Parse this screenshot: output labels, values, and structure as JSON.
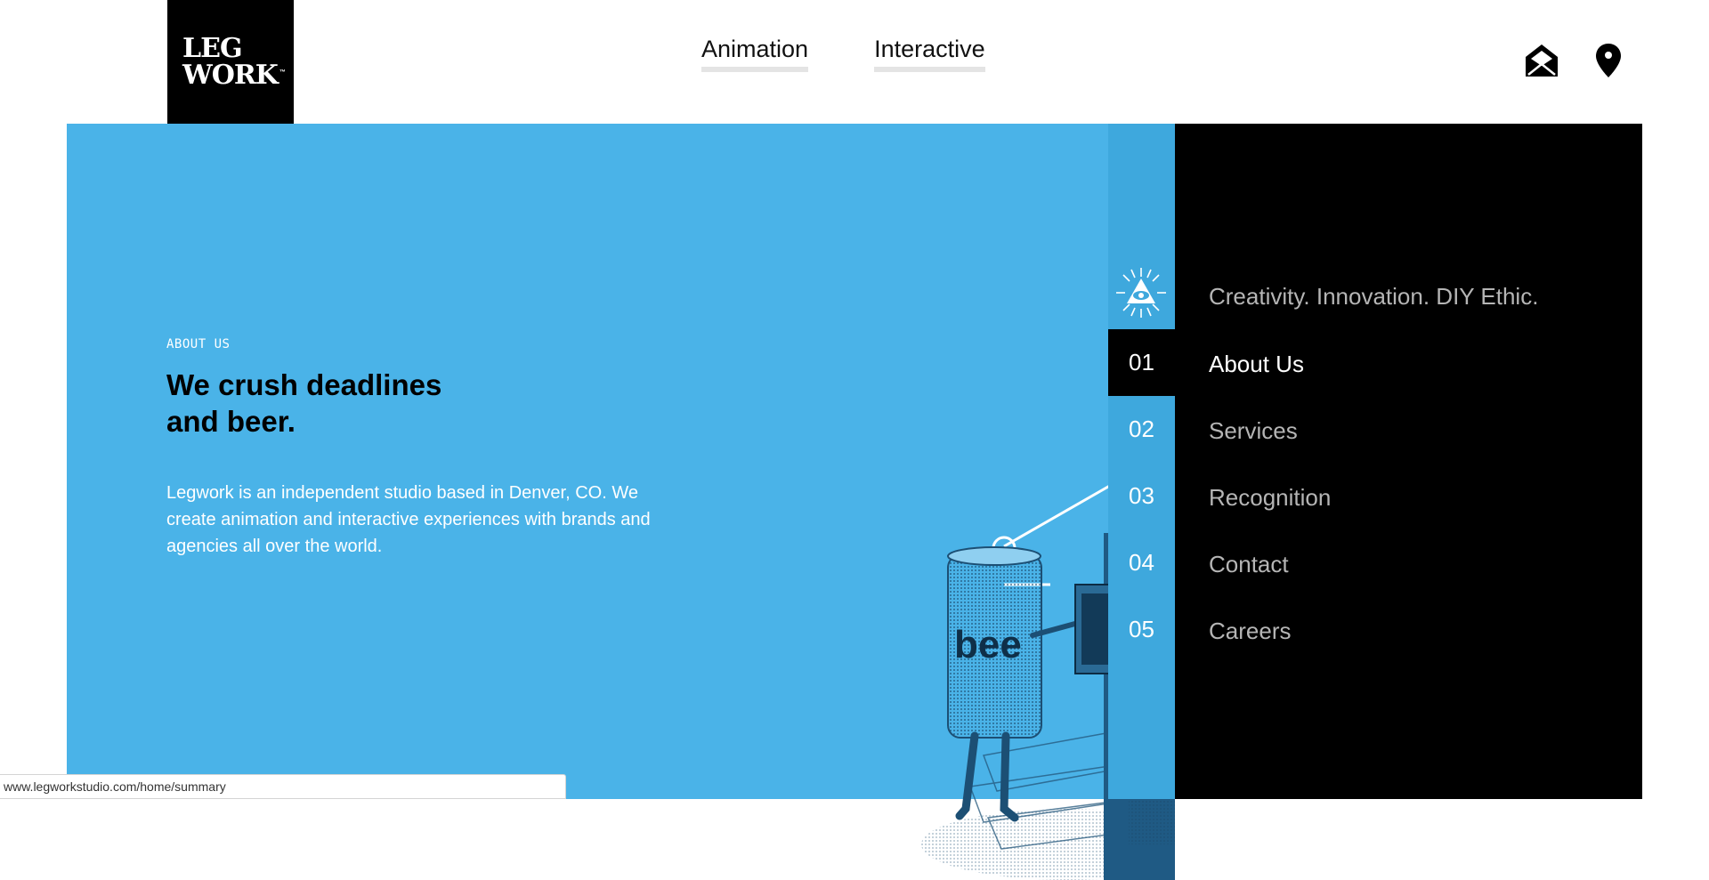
{
  "header": {
    "logo": {
      "line1": "LEG",
      "line2": "WORK",
      "tm": "™"
    },
    "nav": [
      {
        "label": "Animation"
      },
      {
        "label": "Interactive"
      }
    ],
    "icons": [
      "mail-icon",
      "location-pin-icon"
    ]
  },
  "hero": {
    "eyebrow": "ABOUT US",
    "headline_line1": "We crush deadlines",
    "headline_line2": "and beer.",
    "body": "Legwork is an independent studio based in Denver, CO. We create animation and interactive experiences with brands and agencies all over the world.",
    "background_color": "#4ab3e8"
  },
  "side_nav": {
    "tagline": "Creativity. Innovation. DIY Ethic.",
    "icon": "all-seeing-eye-icon",
    "active_index": 0,
    "items": [
      {
        "number": "01",
        "label": "About Us"
      },
      {
        "number": "02",
        "label": "Services"
      },
      {
        "number": "03",
        "label": "Recognition"
      },
      {
        "number": "04",
        "label": "Contact"
      },
      {
        "number": "05",
        "label": "Careers"
      }
    ]
  },
  "status_bar": {
    "url": "www.legworkstudio.com/home/summary"
  }
}
